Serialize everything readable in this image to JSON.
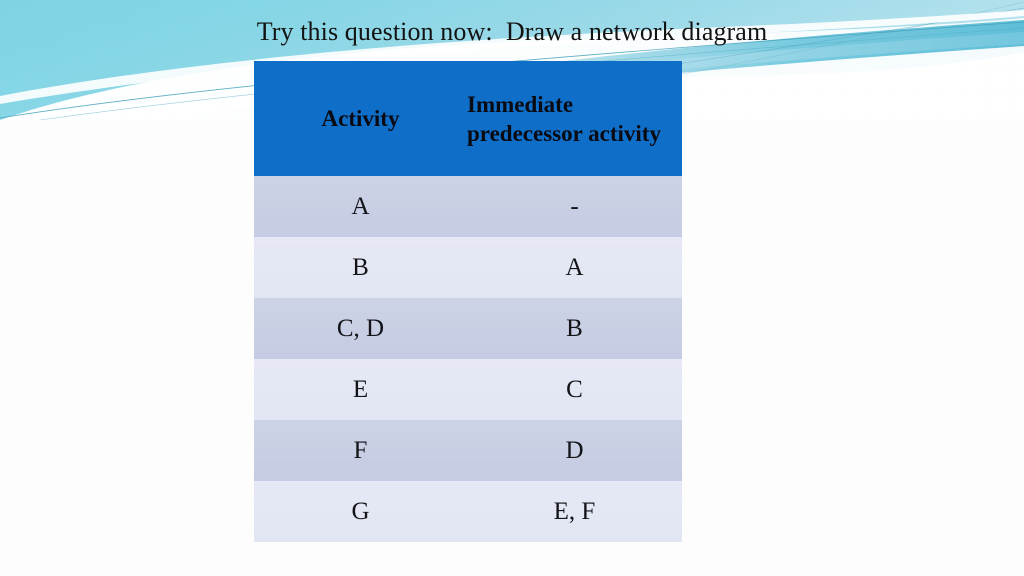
{
  "slide": {
    "title": "Try this question now:  Draw a network diagram",
    "background_color": "#fdfdfe"
  },
  "decoration": {
    "name": "header-wave-graphic",
    "colors": {
      "cyan_light": "#8ddbe8",
      "cyan_mid": "#79cfe2",
      "teal_band": "#5cc0d8",
      "teal_dark_line": "#2f8fa8",
      "pale_blue": "#a9d6e9",
      "white": "#ffffff"
    }
  },
  "table": {
    "name": "activity-predecessor-table",
    "header_background": "#0f6ec8",
    "row_band_dark": "#c8cfe4",
    "row_band_light": "#e3e7f3",
    "headers": [
      "Activity",
      "Immediate predecessor activity"
    ],
    "header_lines": {
      "col1": [
        "Activity"
      ],
      "col2": [
        "Immediate",
        "predecessor",
        "activity"
      ]
    },
    "rows": [
      {
        "activity": "A",
        "predecessor": "-"
      },
      {
        "activity": "B",
        "predecessor": "A"
      },
      {
        "activity": "C, D",
        "predecessor": "B"
      },
      {
        "activity": "E",
        "predecessor": "C"
      },
      {
        "activity": "F",
        "predecessor": "D"
      },
      {
        "activity": "G",
        "predecessor": "E, F"
      }
    ]
  }
}
